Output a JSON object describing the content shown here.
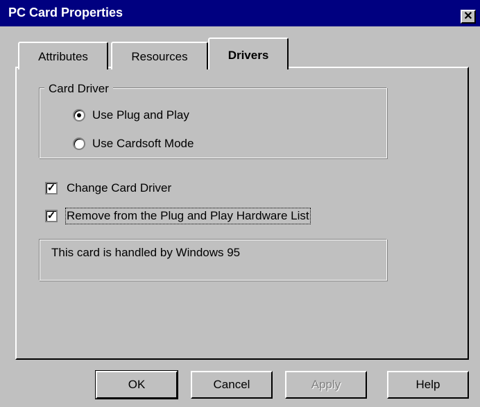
{
  "window": {
    "title": "PC Card Properties",
    "close_glyph": "✕"
  },
  "tabs": [
    {
      "label": "Attributes",
      "active": false
    },
    {
      "label": "Resources",
      "active": false
    },
    {
      "label": "Drivers",
      "active": true
    }
  ],
  "card_driver": {
    "legend": "Card Driver",
    "options": [
      {
        "label": "Use Plug and Play",
        "selected": true
      },
      {
        "label": "Use Cardsoft Mode",
        "selected": false
      }
    ]
  },
  "checkboxes": [
    {
      "label": "Change Card Driver",
      "checked": true
    },
    {
      "label": "Remove from the Plug and Play Hardware List",
      "checked": true
    }
  ],
  "info": {
    "text": "This card is handled by Windows 95"
  },
  "buttons": {
    "ok": "OK",
    "cancel": "Cancel",
    "apply": "Apply",
    "help": "Help"
  },
  "colors": {
    "face": "#c0c0c0",
    "titlebar": "#000080",
    "title_text": "#ffffff",
    "disabled": "#808080"
  }
}
